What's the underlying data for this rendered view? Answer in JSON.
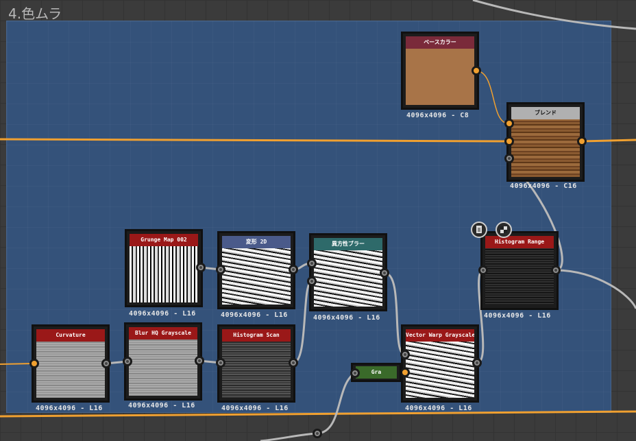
{
  "frame": {
    "title": "4.色ムラ"
  },
  "nodes": {
    "base_color": {
      "title": "ベースカラー",
      "label": "4096x4096 - C8",
      "head_color": "#7a2a3a",
      "swatch": "#a87448"
    },
    "blend": {
      "title": "ブレンド",
      "label": "4096x4096 - C16",
      "head_color": "#b0b0b0"
    },
    "grunge": {
      "title": "Grunge Map 002",
      "label": "4096x4096 - L16",
      "head_color": "#9a1818"
    },
    "transform": {
      "title": "変形 2D",
      "label": "4096x4096 - L16",
      "head_color": "#4a5a8a"
    },
    "aniso": {
      "title": "異方性ブラー",
      "label": "4096x4096 - L16",
      "head_color": "#2e6a6a"
    },
    "hist_range": {
      "title": "Histogram Range",
      "label": "4096x4096 - L16",
      "head_color": "#9a1818"
    },
    "curvature": {
      "title": "Curvature",
      "label": "4096x4096 - L16",
      "head_color": "#9a1818"
    },
    "blur": {
      "title": "Blur HQ Grayscale",
      "label": "4096x4096 - L16",
      "head_color": "#9a1818"
    },
    "hist_scan": {
      "title": "Histogram Scan",
      "label": "4096x4096 - L16",
      "head_color": "#9a1818"
    },
    "vector_warp": {
      "title": "Vector Warp Grayscale",
      "label": "4096x4096 - L16",
      "head_color": "#9a1818"
    },
    "gra": {
      "title": "Gra",
      "head_color": "#3a6a2a"
    }
  },
  "colors": {
    "wire_orange": "#f0a030",
    "wire_grey": "#b8b8b8",
    "frame_bg": "#34527a"
  },
  "icons": [
    "document-icon",
    "checker-icon"
  ]
}
